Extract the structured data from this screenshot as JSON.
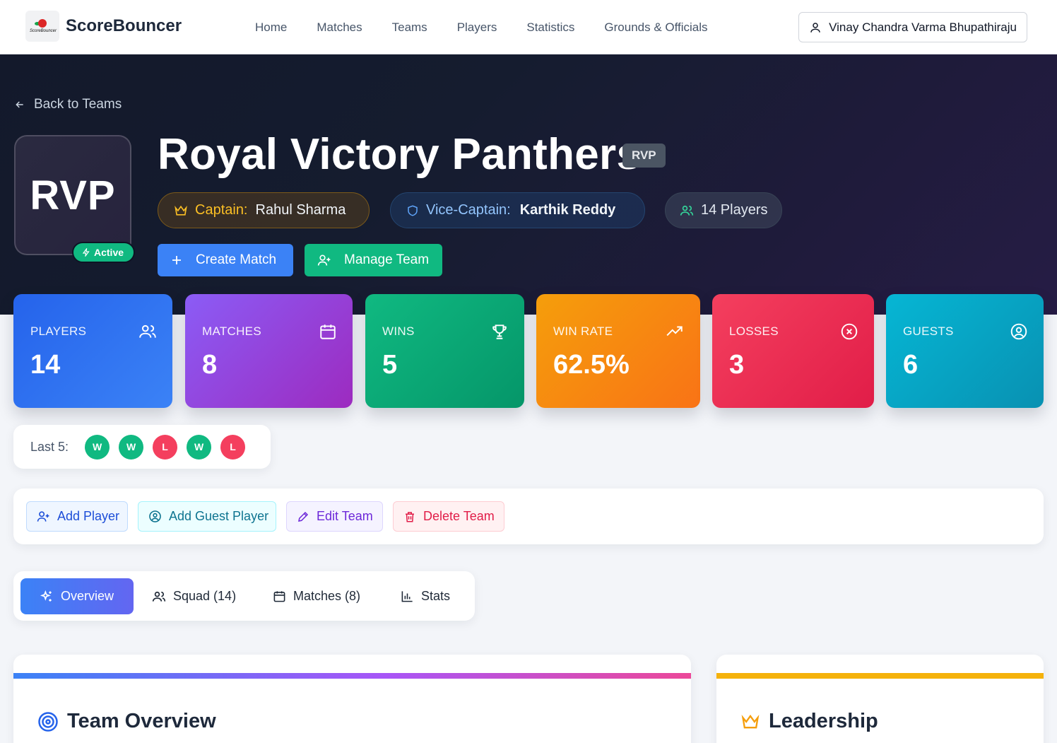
{
  "nav": {
    "brand": "ScoreBouncer",
    "logo_text": "ScoreBouncer",
    "links": [
      "Home",
      "Matches",
      "Teams",
      "Players",
      "Statistics",
      "Grounds & Officials"
    ],
    "user": "Vinay Chandra Varma Bhupathiraju"
  },
  "hero": {
    "back_label": "Back to Teams",
    "avatar_text": "RVP",
    "status_badge": "Active",
    "team_name": "Royal Victory Panthers",
    "short_code": "RVP",
    "captain_label": "Captain:",
    "captain_name": "Rahul Sharma",
    "vice_label": "Vice-Captain:",
    "vice_name": "Karthik Reddy",
    "players_count": "14 Players",
    "create_match": "Create Match",
    "manage_team": "Manage Team"
  },
  "stats": [
    {
      "label": "PLAYERS",
      "value": "14",
      "icon": "users-icon"
    },
    {
      "label": "MATCHES",
      "value": "8",
      "icon": "calendar-icon"
    },
    {
      "label": "WINS",
      "value": "5",
      "icon": "trophy-icon"
    },
    {
      "label": "WIN RATE",
      "value": "62.5%",
      "icon": "trending-up-icon"
    },
    {
      "label": "LOSSES",
      "value": "3",
      "icon": "x-circle-icon"
    },
    {
      "label": "GUESTS",
      "value": "6",
      "icon": "user-circle-icon"
    }
  ],
  "form": {
    "label": "Last 5:",
    "results": [
      "W",
      "W",
      "L",
      "W",
      "L"
    ]
  },
  "actions": {
    "add_player": "Add Player",
    "add_guest": "Add Guest Player",
    "edit_team": "Edit Team",
    "delete_team": "Delete Team"
  },
  "tabs": {
    "overview": "Overview",
    "squad": "Squad (14)",
    "matches": "Matches (8)",
    "stats": "Stats"
  },
  "panels": {
    "overview_title": "Team Overview",
    "leadership_title": "Leadership"
  },
  "colors": {
    "primary": "#3b82f6",
    "success": "#10b981",
    "danger": "#f43f5e",
    "warning": "#f59e0b",
    "hero_bg": "#151c2f"
  }
}
